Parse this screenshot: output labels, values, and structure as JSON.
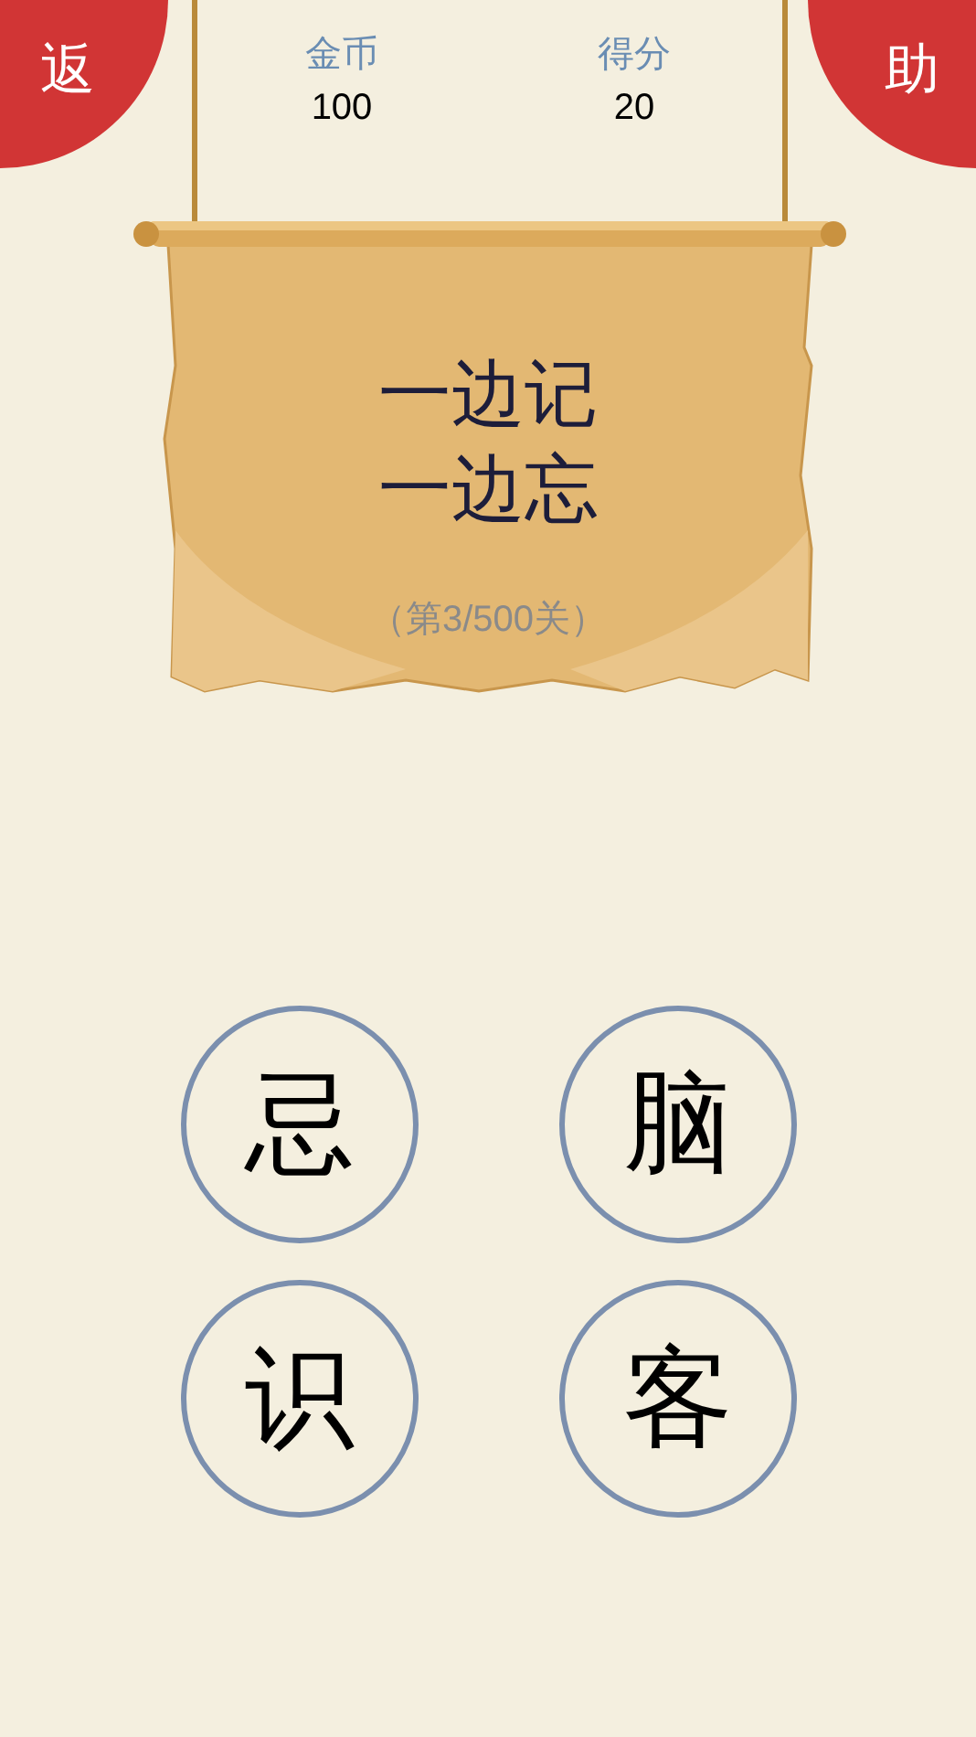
{
  "corner_buttons": [
    {
      "label": "返"
    },
    {
      "label": "助"
    }
  ],
  "stats": [
    {
      "label": "金币",
      "value": "100"
    },
    {
      "label": "得分",
      "value": "20"
    }
  ],
  "riddle": {
    "lines": [
      "一边记",
      "一边忘"
    ],
    "level": "（第3/500关）"
  },
  "choices": [
    "忌",
    "脑",
    "识",
    "客"
  ]
}
